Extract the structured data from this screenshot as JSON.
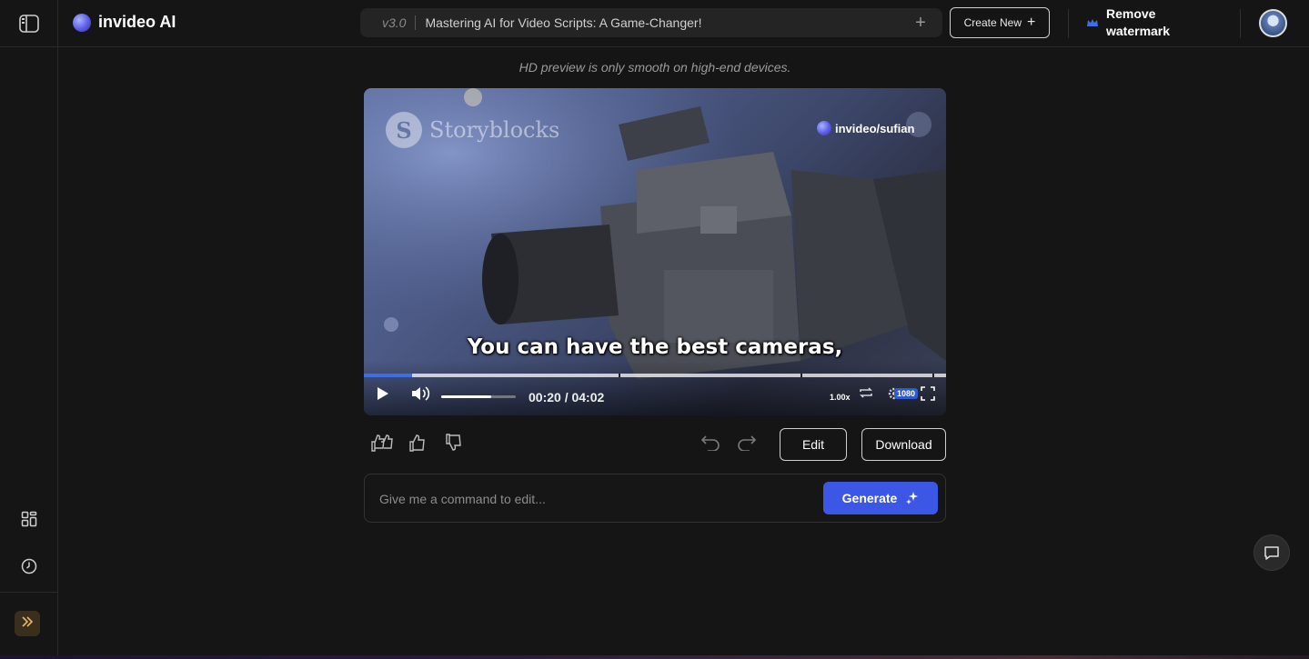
{
  "app": {
    "name": "invideo AI"
  },
  "rail": {
    "toggle_icon": "sidebar-toggle-icon",
    "items": [
      {
        "name": "templates",
        "icon": "grid-icon"
      },
      {
        "name": "history",
        "icon": "clock-icon"
      }
    ],
    "expand_icon": "double-chevron-right-icon"
  },
  "header": {
    "version": "v3.0",
    "title": "Mastering AI for Video Scripts: A Game-Changer!",
    "create_new_label": "Create New",
    "remove_watermark_label": "Remove watermark",
    "crown_color": "#3d6fe0"
  },
  "hint": "HD preview is only smooth on high-end devices.",
  "video": {
    "watermark": "Storyblocks",
    "handle": "invideo/sufian",
    "caption": "You can have the best cameras,",
    "current_time": "00:20",
    "duration": "04:02",
    "time_display": "00:20 / 04:02",
    "progress": 0.083,
    "volume": 0.67,
    "speed": "1.00x",
    "resolution": "1080"
  },
  "actions": {
    "edit_label": "Edit",
    "download_label": "Download"
  },
  "command": {
    "placeholder": "Give me a command to edit...",
    "generate_label": "Generate"
  },
  "colors": {
    "accent": "#3c57e6",
    "background": "#151515"
  }
}
